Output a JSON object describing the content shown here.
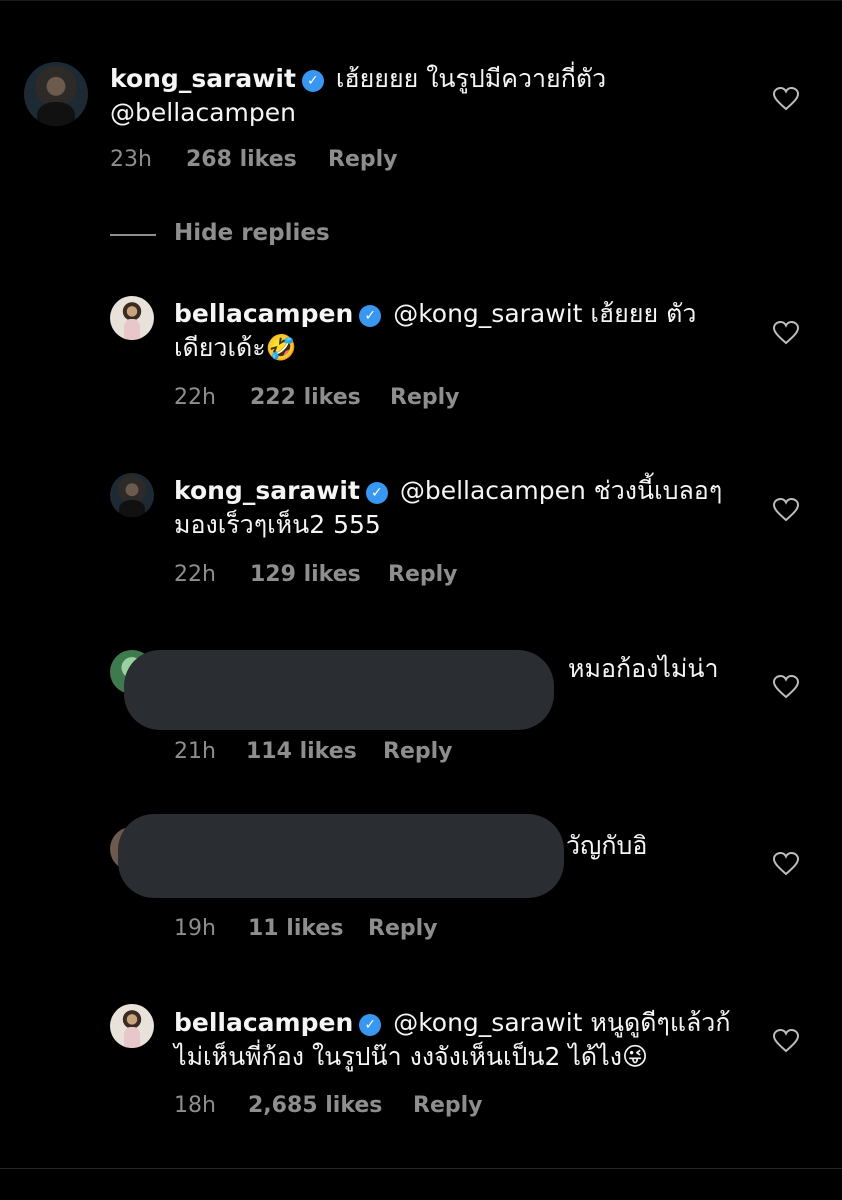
{
  "comments": [
    {
      "username": "kong_sarawit",
      "text": "เฮ้ยยยย ในรูปมีควายกี่ตัว @bellacampen",
      "time": "23h",
      "likes": "268 likes",
      "reply": "Reply"
    }
  ],
  "hide_replies": "Hide replies",
  "replies": [
    {
      "username": "bellacampen",
      "text": "@kong_sarawit เฮ้ยยย ตัวเดียวเด้ะ🤣",
      "time": "22h",
      "likes": "222 likes",
      "reply": "Reply"
    },
    {
      "username": "kong_sarawit",
      "text": "@bellacampen ช่วงนี้เบลอๆ มองเร็วๆเห็น2 555",
      "time": "22h",
      "likes": "129 likes",
      "reply": "Reply"
    },
    {
      "username": "",
      "text": "หมอก้องไม่น่า",
      "time": "21h",
      "likes": "114 likes",
      "reply": "Reply"
    },
    {
      "username": "",
      "text": "วัญกับอิ",
      "time": "19h",
      "likes": "11 likes",
      "reply": "Reply"
    },
    {
      "username": "bellacampen",
      "text": "@kong_sarawit หนูดูดีๆแล้วก้ไม่เห็นพี่ก้อง ในรูปน๊า งงจังเห็นเป็น2 ได้ไง😜",
      "time": "18h",
      "likes": "2,685 likes",
      "reply": "Reply"
    }
  ],
  "icons": {
    "verified": "verified-badge-icon",
    "heart": "heart-outline-icon"
  },
  "colors": {
    "background": "#000000",
    "meta": "#8e8e8e",
    "verified": "#3897f0",
    "redaction": "#2a2d31"
  }
}
